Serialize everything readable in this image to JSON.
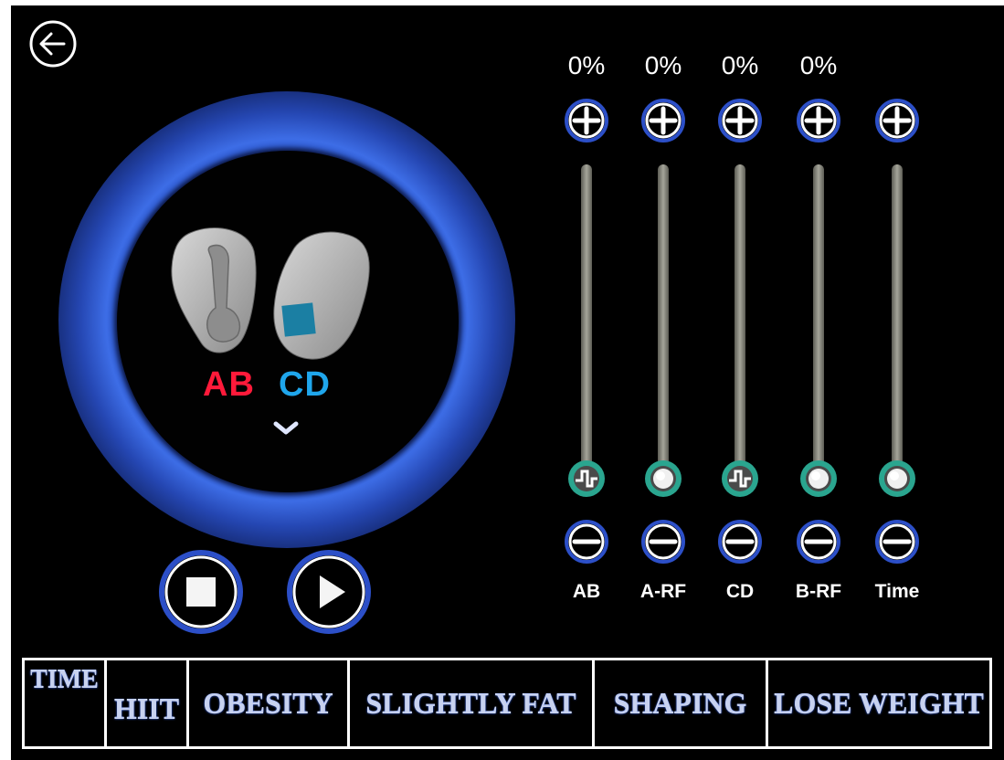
{
  "screen": {
    "electrodes": {
      "ab_label": "AB",
      "cd_label": "CD"
    }
  },
  "channels": [
    {
      "id": "ab",
      "label": "AB",
      "percent": "0%",
      "knob": "wave-icon",
      "level": 0
    },
    {
      "id": "a-rf",
      "label": "A-RF",
      "percent": "0%",
      "knob": "dot-icon",
      "level": 0
    },
    {
      "id": "cd",
      "label": "CD",
      "percent": "0%",
      "knob": "wave-icon",
      "level": 0
    },
    {
      "id": "b-rf",
      "label": "B-RF",
      "percent": "0%",
      "knob": "dot-icon",
      "level": 0
    },
    {
      "id": "time",
      "label": "Time",
      "percent": "",
      "knob": "dot-icon",
      "level": 0
    }
  ],
  "modes": [
    "TIME",
    "HIIT",
    "OBESITY",
    "SLIGHTLY FAT",
    "SHAPING",
    "LOSE WEIGHT"
  ],
  "colors": {
    "ab": "#ff1a3a",
    "cd": "#1fa6ec",
    "glow": "#3d6de6",
    "knob_ring": "#2aa58f"
  }
}
